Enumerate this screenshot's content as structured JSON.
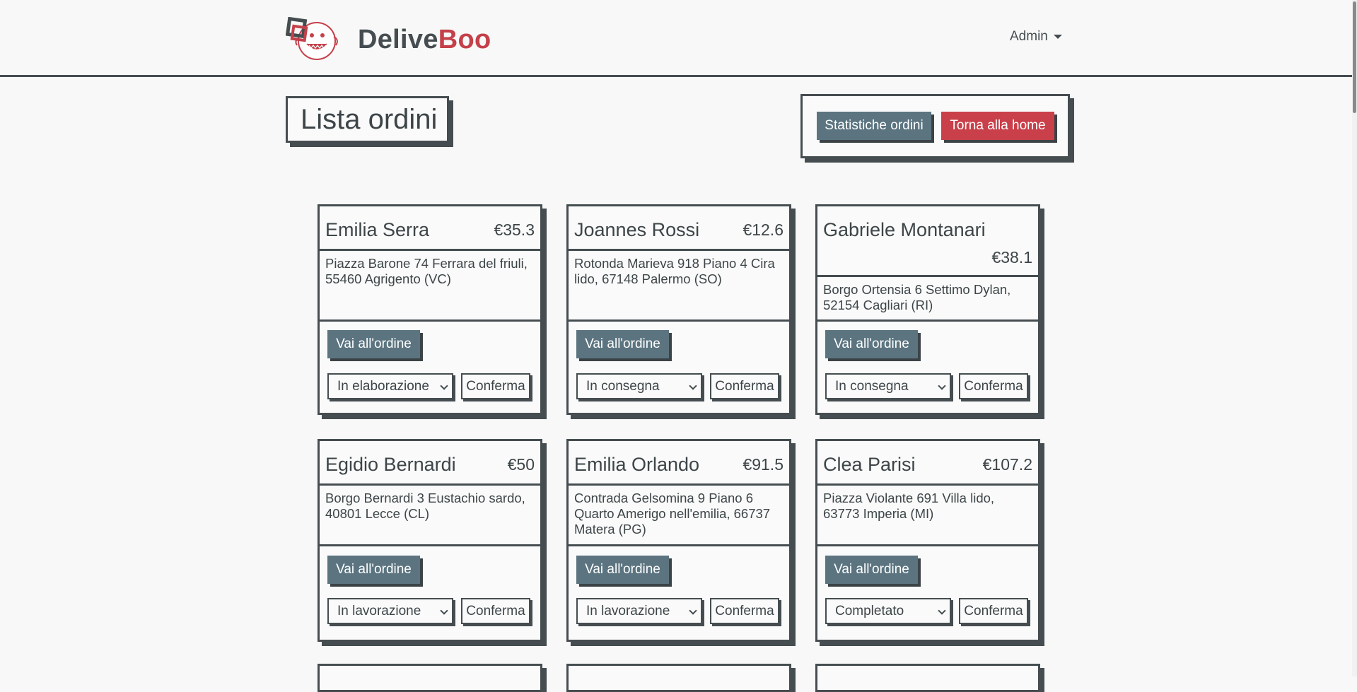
{
  "header": {
    "brand_part1": "Delive",
    "brand_part2": "Boo",
    "user_menu": "Admin"
  },
  "page": {
    "title": "Lista ordini",
    "stats_button": "Statistiche ordini",
    "home_button": "Torna alla home"
  },
  "card_labels": {
    "go_button": "Vai all'ordine",
    "confirm_button": "Conferma"
  },
  "orders": [
    {
      "name": "Emilia Serra",
      "price": "€35.3",
      "address": "Piazza Barone 74 Ferrara del friuli, 55460 Agrigento (VC)",
      "status": "In elaborazione"
    },
    {
      "name": "Joannes Rossi",
      "price": "€12.6",
      "address": "Rotonda Marieva 918 Piano 4 Cira lido, 67148 Palermo (SO)",
      "status": "In consegna"
    },
    {
      "name": "Gabriele Montanari",
      "price": "€38.1",
      "address": "Borgo Ortensia 6 Settimo Dylan, 52154 Cagliari (RI)",
      "status": "In consegna"
    },
    {
      "name": "Egidio Bernardi",
      "price": "€50",
      "address": "Borgo Bernardi 3 Eustachio sardo, 40801 Lecce (CL)",
      "status": "In lavorazione"
    },
    {
      "name": "Emilia Orlando",
      "price": "€91.5",
      "address": "Contrada Gelsomina 9 Piano 6 Quarto Amerigo nell'emilia, 66737 Matera (PG)",
      "status": "In lavorazione"
    },
    {
      "name": "Clea Parisi",
      "price": "€107.2",
      "address": "Piazza Violante 691 Villa lido, 63773 Imperia (MI)",
      "status": "Completato"
    }
  ],
  "colors": {
    "primary_dark": "#454d50",
    "button_slate": "#5b7480",
    "accent_red": "#c9404a",
    "background": "#f8f8f8"
  }
}
